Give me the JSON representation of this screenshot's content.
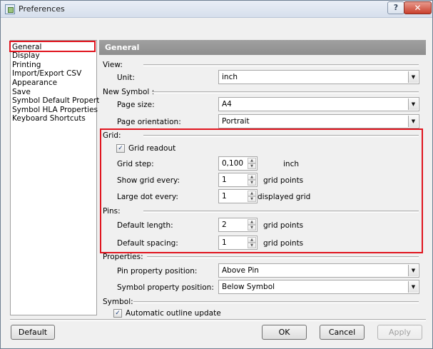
{
  "window": {
    "title": "Preferences",
    "help_label": "?",
    "close_label": "✕"
  },
  "nav": {
    "items": [
      {
        "label": "General"
      },
      {
        "label": "Display"
      },
      {
        "label": "Printing"
      },
      {
        "label": "Import/Export CSV"
      },
      {
        "label": "Appearance"
      },
      {
        "label": "Save"
      },
      {
        "label": "Symbol Default Properties"
      },
      {
        "label": "Symbol HLA Properties"
      },
      {
        "label": "Keyboard Shortcuts"
      }
    ]
  },
  "general": {
    "header": "General",
    "view": {
      "section": "View:",
      "unit_label": "Unit:",
      "unit_value": "inch"
    },
    "new_symbol": {
      "section": "New Symbol :",
      "page_size_label": "Page size:",
      "page_size_value": "A4",
      "orientation_label": "Page orientation:",
      "orientation_value": "Portrait"
    },
    "grid": {
      "section": "Grid:",
      "readout_label": "Grid readout",
      "readout_checked": true,
      "step_label": "Grid step:",
      "step_value": "0,100",
      "step_unit": "inch",
      "show_every_label": "Show grid every:",
      "show_every_value": "1",
      "show_every_unit": "grid points",
      "large_dot_label": "Large dot every:",
      "large_dot_value": "1",
      "large_dot_unit": "displayed grid"
    },
    "pins": {
      "section": "Pins:",
      "default_length_label": "Default length:",
      "default_length_value": "2",
      "default_length_unit": "grid points",
      "default_spacing_label": "Default spacing:",
      "default_spacing_value": "1",
      "default_spacing_unit": "grid points"
    },
    "properties": {
      "section": "Properties:",
      "pin_pos_label": "Pin property position:",
      "pin_pos_value": "Above Pin",
      "symbol_pos_label": "Symbol property position:",
      "symbol_pos_value": "Below Symbol"
    },
    "symbol": {
      "section": "Symbol:",
      "auto_outline_label": "Automatic outline update",
      "auto_outline_checked": true
    }
  },
  "footer": {
    "default_label": "Default",
    "ok_label": "OK",
    "cancel_label": "Cancel",
    "apply_label": "Apply"
  },
  "icons": {
    "dropdown": "▼",
    "spin_up": "▲",
    "spin_down": "▼",
    "check": "✓"
  }
}
